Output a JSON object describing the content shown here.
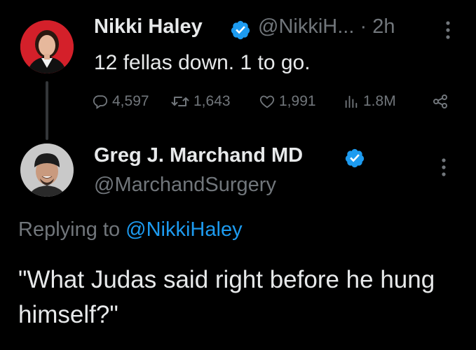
{
  "colors": {
    "background": "#000000",
    "primary_text": "#e7e9ea",
    "secondary_text": "#71767b",
    "accent": "#1d9bf0",
    "thread_line": "#333639"
  },
  "tweet1": {
    "display_name": "Nikki Haley",
    "verified_icon": "verified-badge-icon",
    "handle": "@NikkiH...",
    "separator": "·",
    "time": "2h",
    "text": "12 fellas down. 1 to go.",
    "stats": {
      "replies": "4,597",
      "retweets": "1,643",
      "likes": "1,991",
      "views": "1.8M"
    },
    "icons": [
      "reply-icon",
      "retweet-icon",
      "like-icon",
      "views-icon",
      "share-icon",
      "more-icon"
    ]
  },
  "tweet2": {
    "display_name": "Greg J. Marchand MD",
    "verified_icon": "verified-badge-icon",
    "handle": "@MarchandSurgery",
    "replying_prefix": "Replying to",
    "replying_to": "@NikkiHaley",
    "text": "\"What Judas said right before he hung himself?\""
  }
}
